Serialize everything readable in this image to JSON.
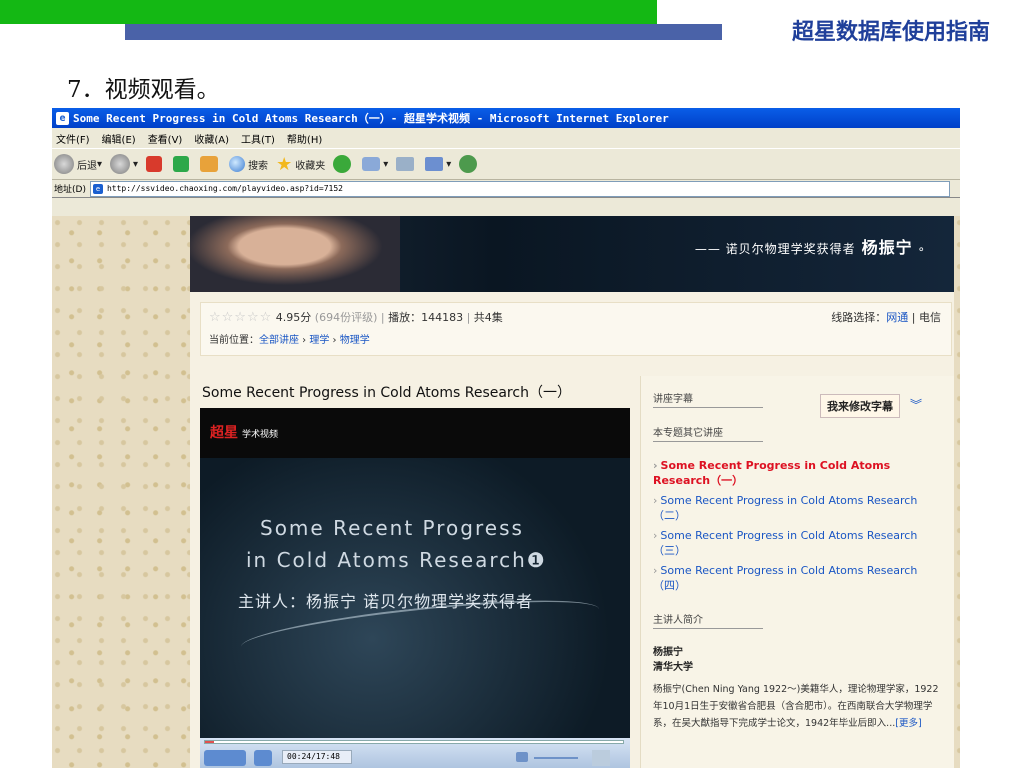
{
  "slide": {
    "title": "超星数据库使用指南",
    "section": "7．视频观看。",
    "colors": {
      "green_bar": "#14b814",
      "blue_bar": "#4a62a8",
      "title": "#1f3f9a"
    }
  },
  "browser": {
    "window_title": "Some Recent Progress in Cold Atoms Research（一）- 超星学术视频 - Microsoft Internet Explorer",
    "menu": [
      "文件(F)",
      "编辑(E)",
      "查看(V)",
      "收藏(A)",
      "工具(T)",
      "帮助(H)"
    ],
    "toolbar": {
      "back": "后退",
      "search": "搜索",
      "favorites": "收藏夹"
    },
    "address_label": "地址(D)",
    "url": "http://ssvideo.chaoxing.com/playvideo.asp?id=7152"
  },
  "banner": {
    "tagline": "诺贝尔物理学奖获得者",
    "name": "杨振宁"
  },
  "info": {
    "stars": "☆☆☆☆☆",
    "score": "4.95分",
    "ratings": "(694份评级)",
    "plays": "播放：144183",
    "episodes": "共4集",
    "route_label": "线路选择：",
    "route_net": "网通",
    "route_tel": "电信",
    "crumb_label": "当前位置：",
    "crumbs": [
      "全部讲座",
      "理学",
      "物理学"
    ]
  },
  "video": {
    "title": "Some Recent Progress in Cold Atoms Research（一）",
    "brand": "超星",
    "brand_sub": "学术视频",
    "line1": "Some Recent Progress",
    "line2": "in Cold Atoms Research❶",
    "line3": "主讲人：杨振宁 诺贝尔物理学奖获得者",
    "time": "00:24/17:48",
    "progress_fraction": 0.0225
  },
  "sidebar": {
    "subtitle_head": "讲座字幕",
    "edit_button": "我来修改字幕",
    "other_head": "本专题其它讲座",
    "lectures": [
      "Some Recent Progress in Cold Atoms Research（一）",
      "Some Recent Progress in Cold Atoms Research（二）",
      "Some Recent Progress in Cold Atoms Research（三）",
      "Some Recent Progress in Cold Atoms Research（四）"
    ],
    "speaker_head": "主讲人简介",
    "speaker_name": "杨振宁",
    "speaker_org": "清华大学",
    "bio": "杨振宁(Chen Ning Yang 1922～)美籍华人，理论物理学家，1922年10月1日生于安徽省合肥县（含合肥市）。在西南联合大学物理学系，在吴大猷指导下完成学士论文，1942年毕业后即入...",
    "more": "[更多]"
  }
}
